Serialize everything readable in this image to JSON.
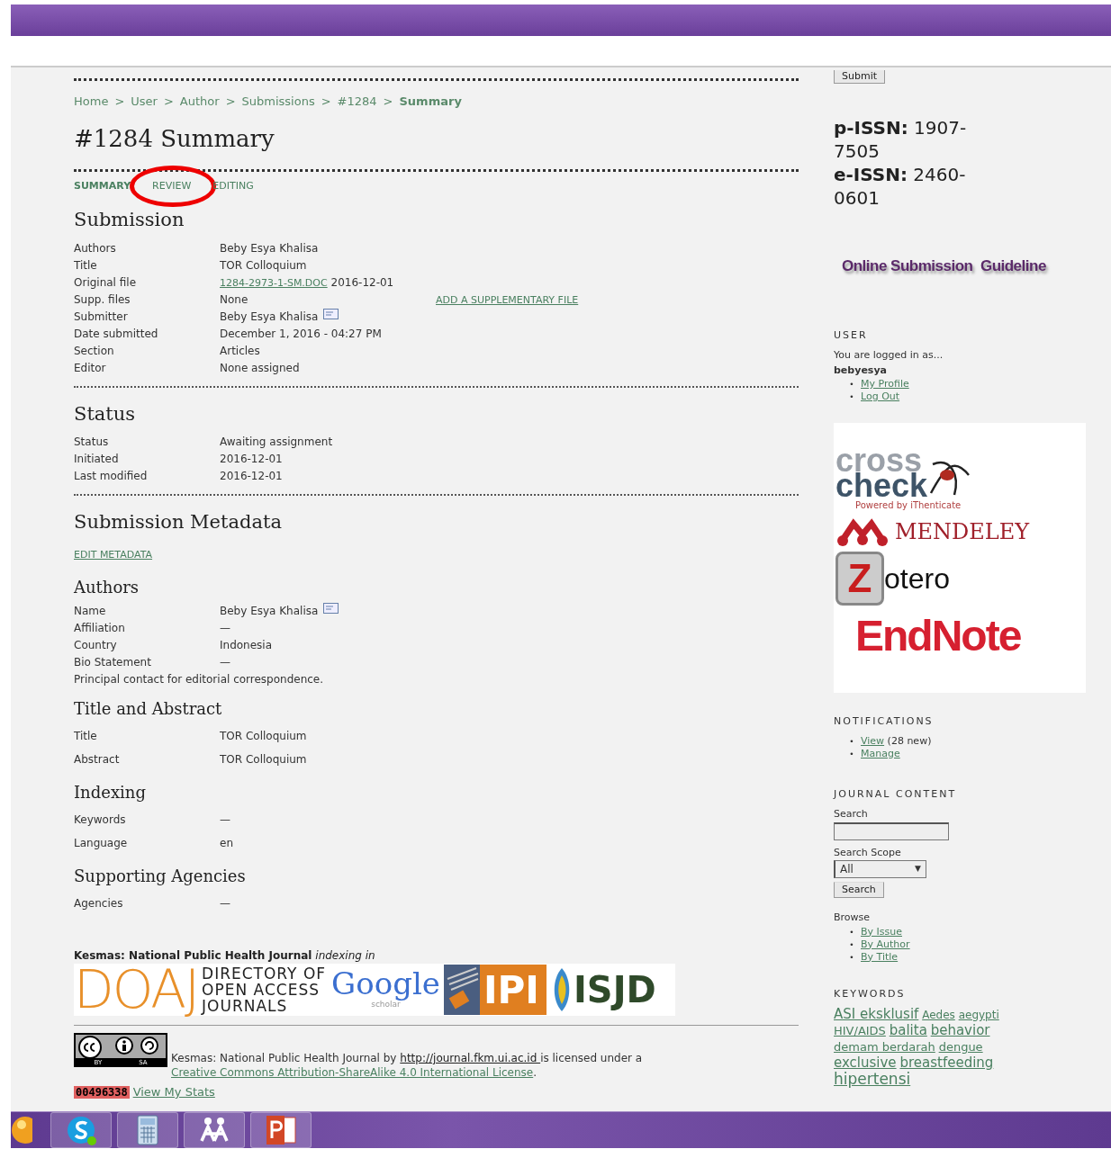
{
  "breadcrumb": [
    {
      "kind": "link",
      "label": "Home"
    },
    {
      "kind": "sep",
      "label": ">"
    },
    {
      "kind": "link",
      "label": "User"
    },
    {
      "kind": "sep",
      "label": ">"
    },
    {
      "kind": "link",
      "label": "Author"
    },
    {
      "kind": "sep",
      "label": ">"
    },
    {
      "kind": "link",
      "label": "Submissions"
    },
    {
      "kind": "sep",
      "label": ">"
    },
    {
      "kind": "link",
      "label": "#1284"
    },
    {
      "kind": "sep",
      "label": ">"
    },
    {
      "kind": "current",
      "label": "Summary"
    }
  ],
  "page_title": "#1284 Summary",
  "tabs": [
    {
      "label": "SUMMARY",
      "selected": true,
      "circled": false
    },
    {
      "label": "REVIEW",
      "selected": false,
      "circled": true
    },
    {
      "label": "EDITING",
      "selected": false,
      "circled": false
    }
  ],
  "submission": {
    "heading": "Submission",
    "rows": [
      {
        "label": "Authors",
        "value": "Beby Esya Khalisa"
      },
      {
        "label": "Title",
        "value": "TOR Colloquium"
      },
      {
        "label": "Original file",
        "file_link": "1284-2973-1-SM.DOC",
        "value": "2016-12-01"
      },
      {
        "label": "Supp. files",
        "value": "None",
        "action": "ADD A SUPPLEMENTARY FILE"
      },
      {
        "label": "Submitter",
        "value": "Beby Esya Khalisa",
        "mail": true
      },
      {
        "label": "Date submitted",
        "value": "December 1, 2016 - 04:27 PM"
      },
      {
        "label": "Section",
        "value": "Articles"
      },
      {
        "label": "Editor",
        "value": "None assigned"
      }
    ]
  },
  "status": {
    "heading": "Status",
    "rows": [
      {
        "label": "Status",
        "value": "Awaiting assignment"
      },
      {
        "label": "Initiated",
        "value": "2016-12-01"
      },
      {
        "label": "Last modified",
        "value": "2016-12-01"
      }
    ]
  },
  "metadata": {
    "heading": "Submission Metadata",
    "edit_link": "EDIT METADATA",
    "groups": [
      {
        "heading": "Authors",
        "rows": [
          {
            "label": "Name",
            "value": "Beby Esya Khalisa",
            "mail": true
          },
          {
            "label": "Affiliation",
            "value": "—"
          },
          {
            "label": "Country",
            "value": "Indonesia"
          },
          {
            "label": "Bio Statement",
            "value": "—"
          }
        ],
        "note": "Principal contact for editorial correspondence."
      },
      {
        "heading": "Title and Abstract",
        "spaced": true,
        "rows": [
          {
            "label": "Title",
            "value": "TOR Colloquium"
          },
          {
            "label": "Abstract",
            "value": "TOR Colloquium"
          }
        ]
      },
      {
        "heading": "Indexing",
        "spaced": true,
        "rows": [
          {
            "label": "Keywords",
            "value": "—"
          },
          {
            "label": "Language",
            "value": "en"
          }
        ]
      },
      {
        "heading": "Supporting Agencies",
        "spaced": true,
        "rows": [
          {
            "label": "Agencies",
            "value": "—"
          }
        ]
      }
    ]
  },
  "footer": {
    "indexing_text": "**Kesmas: National Public Health Journal** *indexing in*",
    "index_logos": [
      {
        "kind": "doaj",
        "texts": [
          "DOAJ",
          "DIRECTORY OF",
          "OPEN ACCESS",
          "JOURNALS"
        ]
      },
      {
        "kind": "google",
        "texts": [
          "Google",
          "scholar"
        ]
      },
      {
        "kind": "ipi",
        "texts": [
          "IPI"
        ]
      },
      {
        "kind": "isjd",
        "texts": [
          "ISJD"
        ]
      }
    ],
    "cc_badge": [
      "BY",
      "SA"
    ],
    "license": {
      "before": "Kesmas: National Public Health Journal by ",
      "site_link": "http://journal.fkm.ui.ac.id ",
      "middle": " is licensed under a ",
      "license_link": "Creative Commons Attribution-ShareAlike 4.0 International License",
      "after": "."
    },
    "counter": "00496338",
    "stats_link": "View My Stats"
  },
  "sidebar": {
    "submit_button": "Submit",
    "issn": [
      "**p-ISSN:** 1907-7505",
      "**e-ISSN:** 2460-0601"
    ],
    "guideline": "Online Submission  Guideline",
    "user": {
      "heading": "USER",
      "logged_in": "You are logged in as...",
      "username": "bebyesya",
      "links": [
        {
          "bullet": "•",
          "label": "My Profile"
        },
        {
          "bullet": "•",
          "label": "Log Out"
        }
      ]
    },
    "tools_logos": {
      "crosscheck": [
        "cross",
        "check",
        "Powered by iThenticate"
      ],
      "mendeley": "MENDELEY",
      "zotero": [
        "Z",
        "otero"
      ],
      "endnote": "EndNote"
    },
    "notifications": {
      "heading": "NOTIFICATIONS",
      "items": [
        {
          "bullet": "•",
          "link": "View",
          "note": "(28 new)"
        },
        {
          "bullet": "•",
          "link": "Manage"
        }
      ]
    },
    "journal_content": {
      "heading": "JOURNAL CONTENT",
      "search_label": "Search",
      "scope_label": "Search Scope",
      "scope_value": "All",
      "scope_caret": "▼",
      "search_button": "Search",
      "browse_label": "Browse",
      "browse_links": [
        {
          "bullet": "•",
          "label": "By Issue"
        },
        {
          "bullet": "•",
          "label": "By Author"
        },
        {
          "bullet": "•",
          "label": "By Title"
        }
      ]
    },
    "keywords": {
      "heading": "KEYWORDS",
      "tags": [
        {
          "label": "ASI eksklusif",
          "kind": "large"
        },
        {
          "label": "Aedes",
          "kind": "small"
        },
        {
          "label": "aegypti",
          "kind": "small"
        },
        {
          "label": "HIV/AIDS",
          "kind": "medium"
        },
        {
          "label": "balita",
          "kind": "large"
        },
        {
          "label": "behavior",
          "kind": "large"
        },
        {
          "label": "demam berdarah",
          "kind": "medium"
        },
        {
          "label": "dengue",
          "kind": "medium"
        },
        {
          "label": "exclusive",
          "kind": "large"
        },
        {
          "label": "breastfeeding",
          "kind": "large"
        },
        {
          "label": "hipertensi",
          "kind": "xlarge"
        }
      ]
    }
  },
  "taskbar": [
    {
      "kind": "orb"
    },
    {
      "kind": "skype"
    },
    {
      "kind": "calculator"
    },
    {
      "kind": "network"
    },
    {
      "kind": "powerpoint"
    }
  ]
}
